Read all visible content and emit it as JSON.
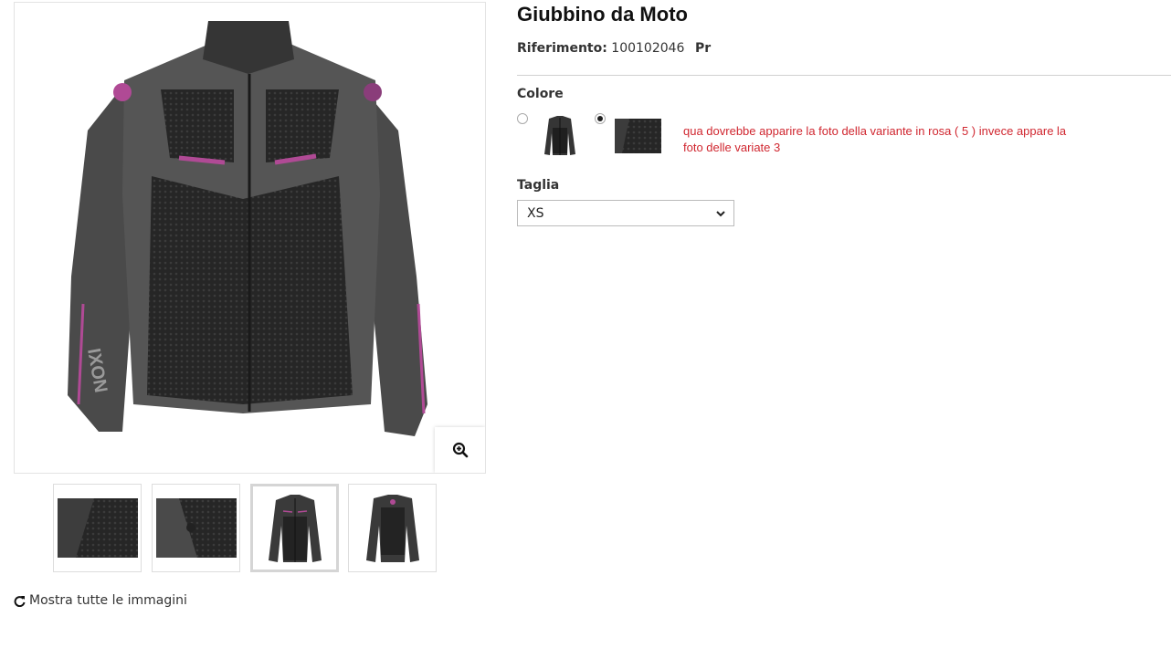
{
  "product": {
    "title": "Giubbino da Moto",
    "reference_label": "Riferimento:",
    "reference_value": "100102046",
    "reference_prefix_partial": "Pr"
  },
  "gallery": {
    "zoom_icon": "zoom-in-icon",
    "thumbnails": [
      "mesh-detail",
      "pocket-detail",
      "jacket-front",
      "jacket-back"
    ],
    "active_thumbnail": 2,
    "show_all_label": "Mostra tutte le immagini",
    "show_all_icon": "refresh-icon"
  },
  "options": {
    "color_label": "Colore",
    "color_selected_index": 1,
    "size_label": "Taglia",
    "size_value": "XS",
    "size_icon": "chevron-down-icon"
  },
  "annotation": {
    "text": "qua dovrebbe apparire la foto della variante in rosa ( 5 ) invece appare la foto delle variate 3",
    "color": "#d0262f"
  },
  "colors": {
    "jacket_dark": "#2b2b2b",
    "jacket_grey": "#5a5a5a",
    "accent_pink": "#b04a95"
  }
}
